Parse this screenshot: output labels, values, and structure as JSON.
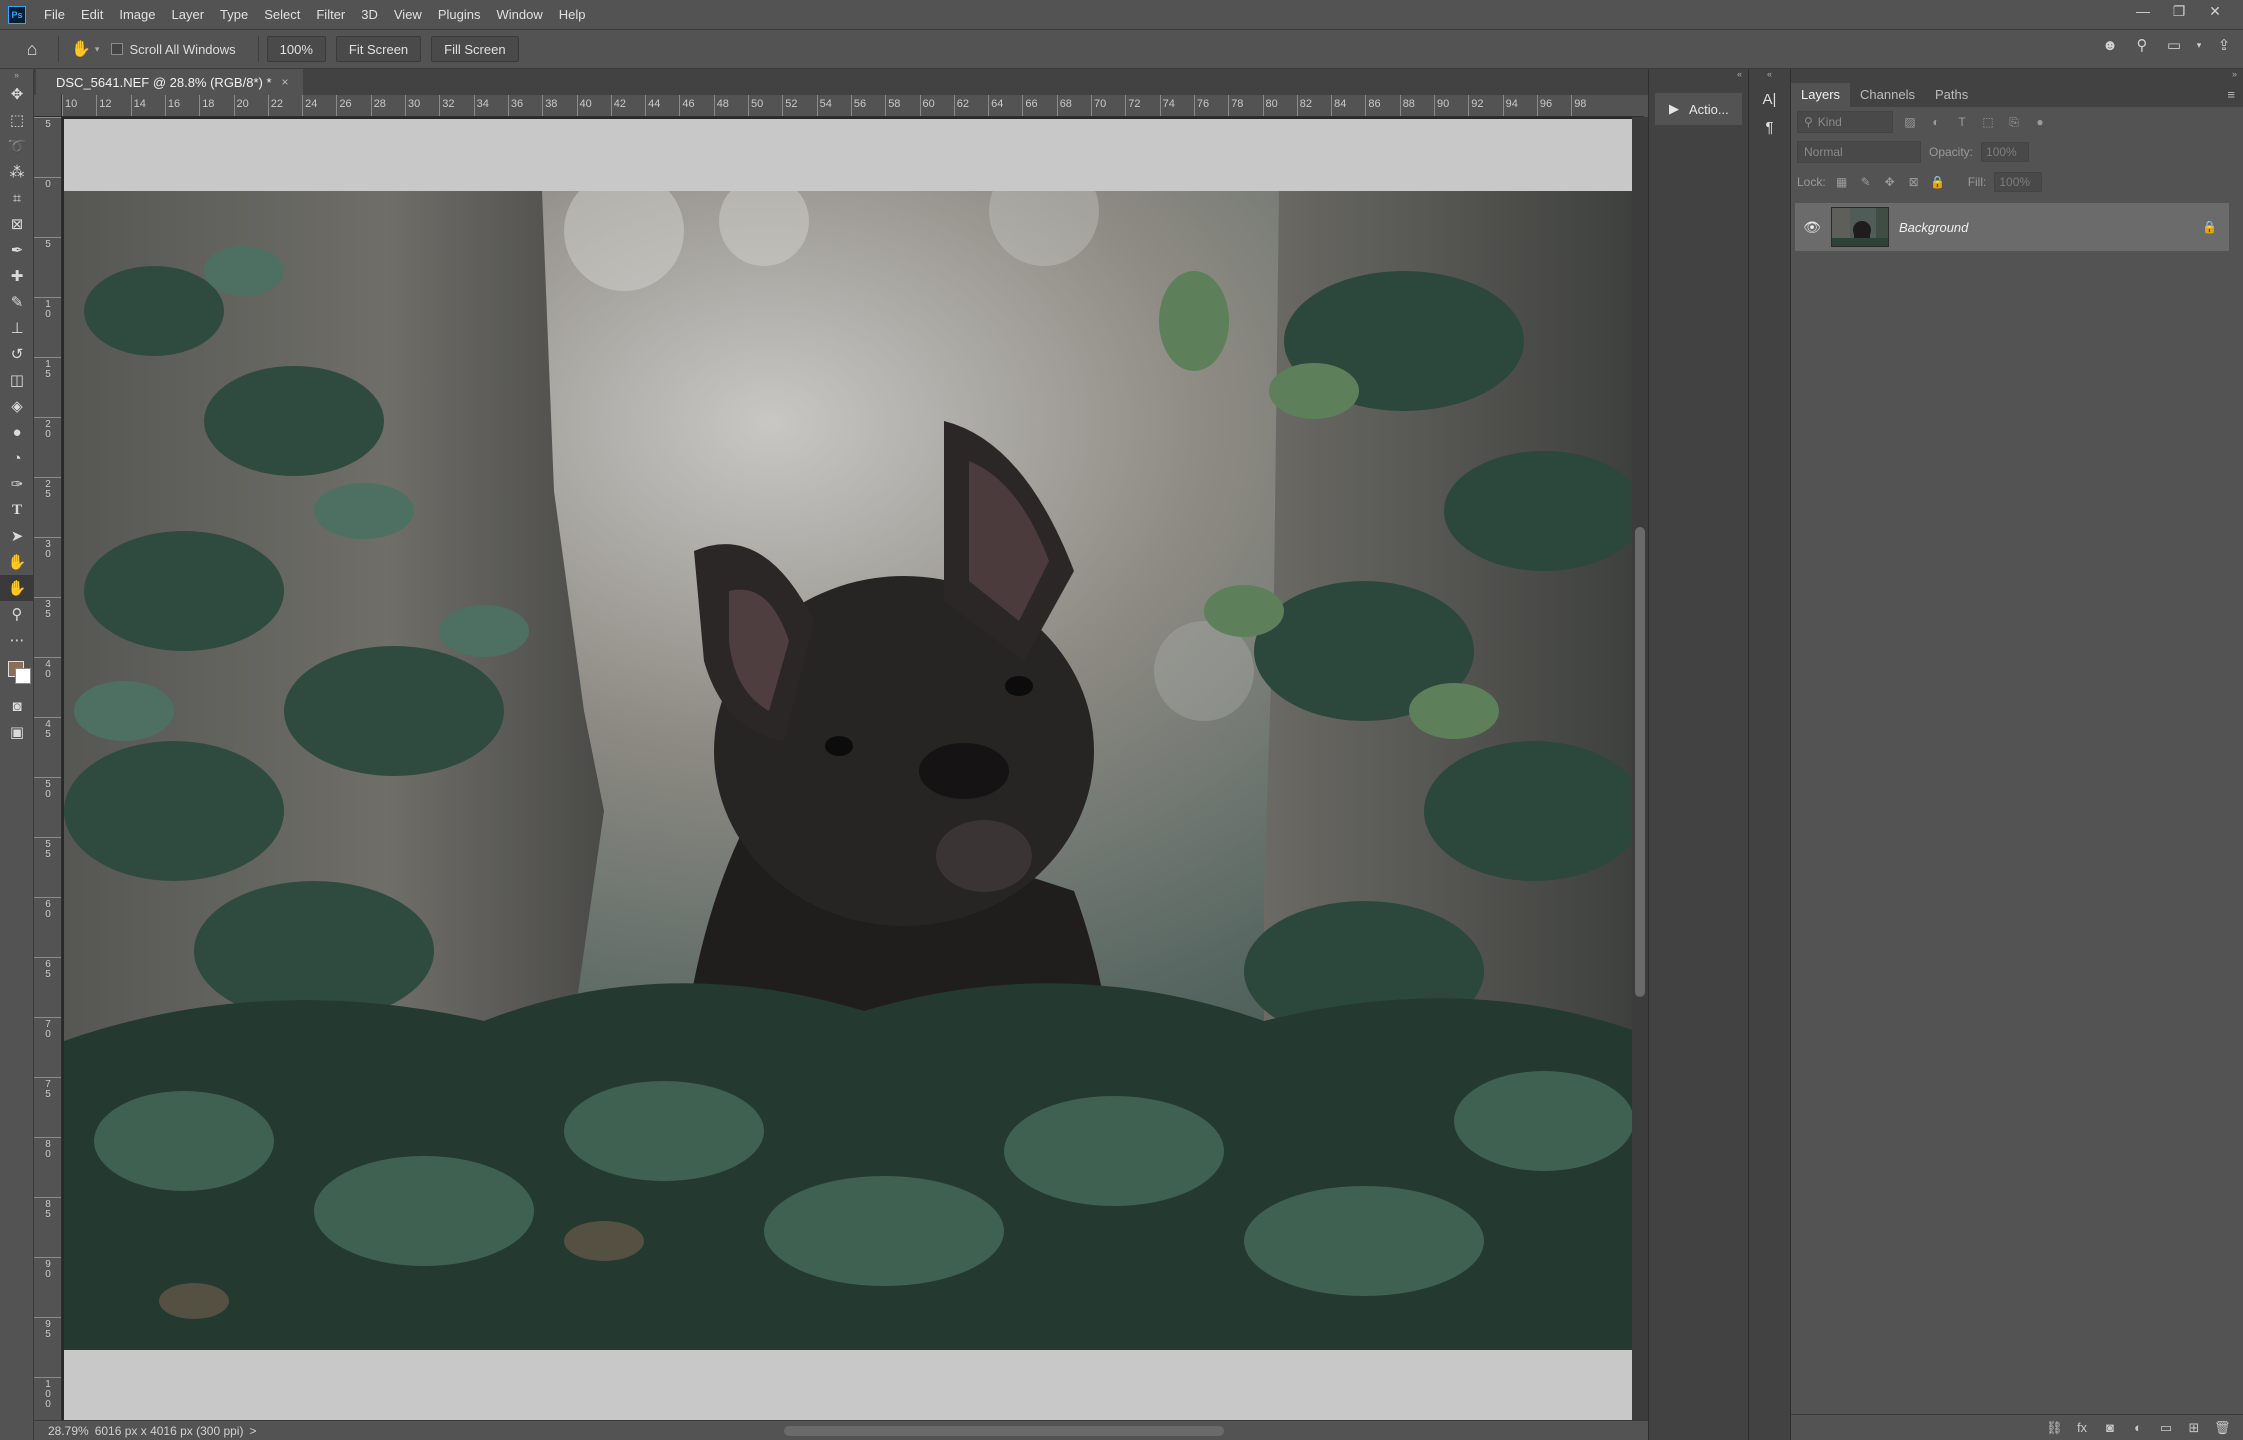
{
  "app": {
    "logo": "Ps"
  },
  "menu": [
    "File",
    "Edit",
    "Image",
    "Layer",
    "Type",
    "Select",
    "Filter",
    "3D",
    "View",
    "Plugins",
    "Window",
    "Help"
  ],
  "window_controls": {
    "minimize": "—",
    "restore": "❐",
    "close": "✕"
  },
  "options": {
    "home_icon": "home-icon",
    "tool_icon": "hand-icon",
    "scroll_all_label": "Scroll All Windows",
    "zoom_btn": "100%",
    "fit_screen_btn": "Fit Screen",
    "fill_screen_btn": "Fill Screen"
  },
  "document": {
    "tab_title": "DSC_5641.NEF @ 28.8% (RGB/8*) *",
    "close": "×"
  },
  "ruler_top": [
    "10",
    "12",
    "14",
    "16",
    "18",
    "20",
    "22",
    "24",
    "26",
    "28",
    "30",
    "32",
    "34",
    "36",
    "38",
    "40",
    "42",
    "44",
    "46",
    "48",
    "50",
    "52",
    "54",
    "56",
    "58",
    "60",
    "62",
    "64",
    "66",
    "68",
    "70",
    "72",
    "74",
    "76",
    "78",
    "80",
    "82",
    "84",
    "86",
    "88",
    "90",
    "92",
    "94",
    "96",
    "98"
  ],
  "ruler_left": [
    "5",
    "0",
    "5",
    "10",
    "15",
    "20",
    "25",
    "30",
    "35",
    "40",
    "45",
    "50",
    "55",
    "60",
    "65",
    "70",
    "75",
    "80",
    "85",
    "90",
    "95",
    "100"
  ],
  "status": {
    "zoom": "28.79%",
    "info": "6016 px x 4016 px (300 ppi)",
    "arrow": ">"
  },
  "actions_panel": {
    "label": "Actio..."
  },
  "layers_panel": {
    "tabs": [
      "Layers",
      "Channels",
      "Paths"
    ],
    "kind_placeholder": "Kind",
    "blend_mode": "Normal",
    "opacity_label": "Opacity:",
    "opacity_value": "100%",
    "lock_label": "Lock:",
    "fill_label": "Fill:",
    "fill_value": "100%",
    "layers": [
      {
        "name": "Background",
        "visible": true,
        "locked": true
      }
    ]
  },
  "colors": {
    "accent": "#31a8ff",
    "foreground_swatch": "#8a6e5a",
    "background_swatch": "#ffffff"
  }
}
